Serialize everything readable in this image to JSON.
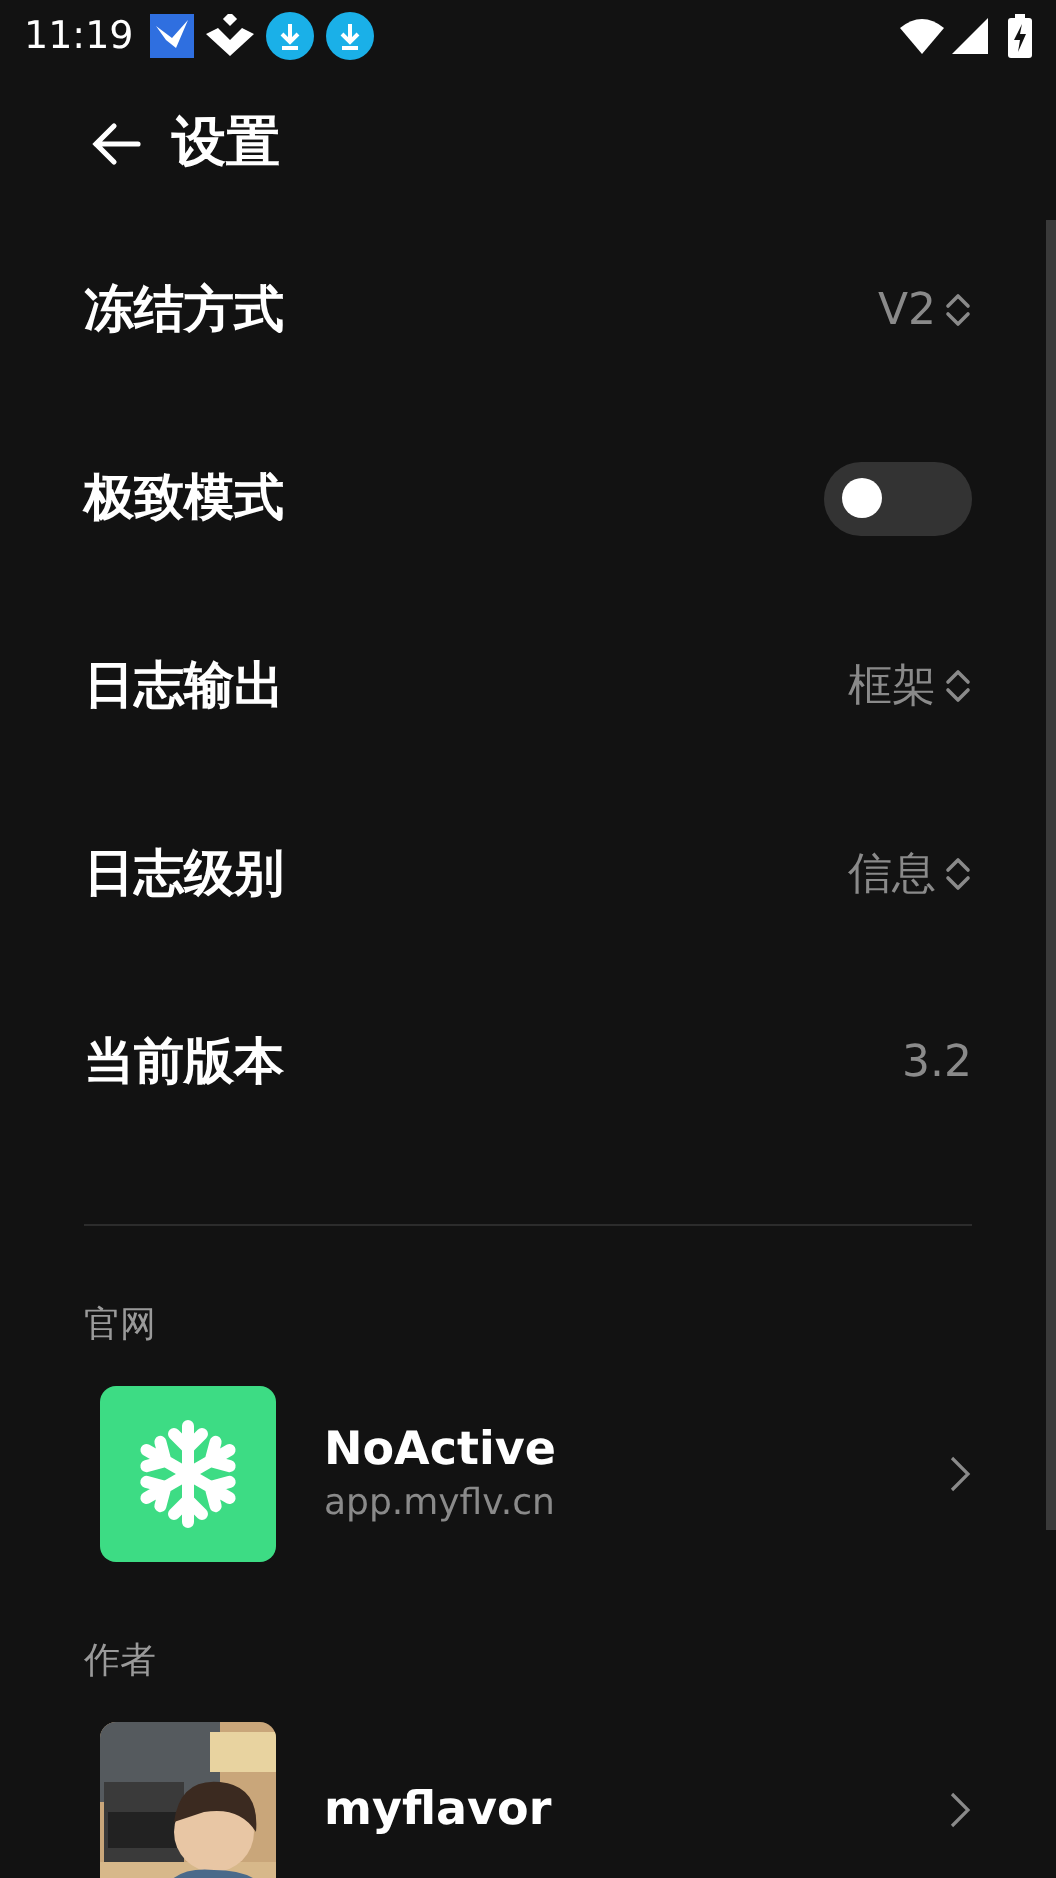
{
  "status_bar": {
    "time": "11:19"
  },
  "header": {
    "title": "设置"
  },
  "settings": [
    {
      "kind": "select",
      "label": "冻结方式",
      "value": "V2"
    },
    {
      "kind": "toggle",
      "label": "极致模式",
      "on": false
    },
    {
      "kind": "select",
      "label": "日志输出",
      "value": "框架"
    },
    {
      "kind": "select",
      "label": "日志级别",
      "value": "信息"
    },
    {
      "kind": "text",
      "label": "当前版本",
      "value": "3.2"
    }
  ],
  "links": [
    {
      "heading": "官网",
      "title": "NoActive",
      "subtitle": "app.myflv.cn",
      "image": {
        "kind": "snowflake"
      }
    },
    {
      "heading": "作者",
      "title": "myflavor"
    }
  ]
}
